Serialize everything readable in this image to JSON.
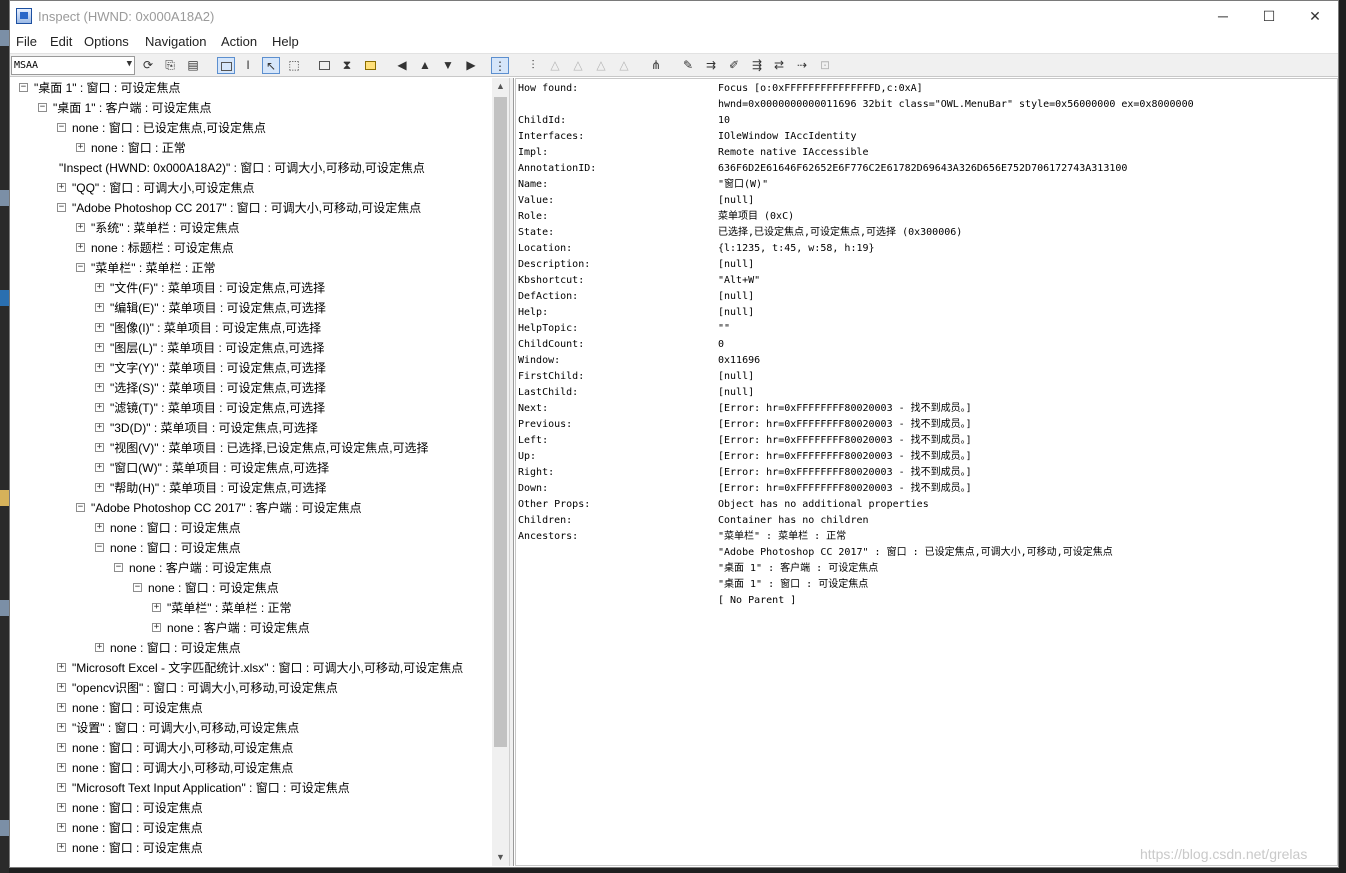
{
  "window": {
    "title": "Inspect  (HWND: 0x000A18A2)",
    "controls": {
      "minimize": "─",
      "maximize": "☐",
      "close": "✕"
    }
  },
  "menu": [
    "File",
    "Edit",
    "Options",
    "Navigation",
    "Action",
    "Help"
  ],
  "toolbar": {
    "mode": "MSAA"
  },
  "tree": [
    {
      "text": "\"桌面 1\" : 窗口 : 可设定焦点",
      "exp": "−"
    },
    {
      "text": "\"桌面 1\" : 客户端 : 可设定焦点",
      "exp": "−"
    },
    {
      "text": "none : 窗口 : 已设定焦点,可设定焦点",
      "exp": "−"
    },
    {
      "text": "none : 窗口 : 正常",
      "exp": "+"
    },
    {
      "text": "\"Inspect  (HWND: 0x000A18A2)\" : 窗口 : 可调大小,可移动,可设定焦点",
      "exp": ""
    },
    {
      "text": "\"QQ\" : 窗口 : 可调大小,可设定焦点",
      "exp": "+"
    },
    {
      "text": "\"Adobe Photoshop CC 2017\" : 窗口 : 可调大小,可移动,可设定焦点",
      "exp": "−"
    },
    {
      "text": "\"系统\" : 菜单栏 : 可设定焦点",
      "exp": "+"
    },
    {
      "text": "none : 标题栏 : 可设定焦点",
      "exp": "+"
    },
    {
      "text": "\"菜单栏\" : 菜单栏 : 正常",
      "exp": "−"
    },
    {
      "text": "\"文件(F)\" : 菜单项目 : 可设定焦点,可选择",
      "exp": "+"
    },
    {
      "text": "\"编辑(E)\" : 菜单项目 : 可设定焦点,可选择",
      "exp": "+"
    },
    {
      "text": "\"图像(I)\" : 菜单项目 : 可设定焦点,可选择",
      "exp": "+"
    },
    {
      "text": "\"图层(L)\" : 菜单项目 : 可设定焦点,可选择",
      "exp": "+"
    },
    {
      "text": "\"文字(Y)\" : 菜单项目 : 可设定焦点,可选择",
      "exp": "+"
    },
    {
      "text": "\"选择(S)\" : 菜单项目 : 可设定焦点,可选择",
      "exp": "+"
    },
    {
      "text": "\"滤镜(T)\" : 菜单项目 : 可设定焦点,可选择",
      "exp": "+"
    },
    {
      "text": "\"3D(D)\" : 菜单项目 : 可设定焦点,可选择",
      "exp": "+"
    },
    {
      "text": "\"视图(V)\" : 菜单项目 : 已选择,已设定焦点,可设定焦点,可选择",
      "exp": "+"
    },
    {
      "text": "\"窗口(W)\" : 菜单项目 : 可设定焦点,可选择",
      "exp": "+"
    },
    {
      "text": "\"帮助(H)\" : 菜单项目 : 可设定焦点,可选择",
      "exp": "+"
    },
    {
      "text": "\"Adobe Photoshop CC 2017\" : 客户端 : 可设定焦点",
      "exp": "−"
    },
    {
      "text": "none : 窗口 : 可设定焦点",
      "exp": "+"
    },
    {
      "text": "none : 窗口 : 可设定焦点",
      "exp": "−"
    },
    {
      "text": "none : 客户端 : 可设定焦点",
      "exp": "−"
    },
    {
      "text": "none : 窗口 : 可设定焦点",
      "exp": "−"
    },
    {
      "text": "\"菜单栏\" : 菜单栏 : 正常",
      "exp": "+"
    },
    {
      "text": "none : 客户端 : 可设定焦点",
      "exp": "+"
    },
    {
      "text": "none : 窗口 : 可设定焦点",
      "exp": "+"
    },
    {
      "text": "\"Microsoft Excel - 文字匹配统计.xlsx\" : 窗口 : 可调大小,可移动,可设定焦点",
      "exp": "+"
    },
    {
      "text": "\"opencv识图\" : 窗口 : 可调大小,可移动,可设定焦点",
      "exp": "+"
    },
    {
      "text": "none : 窗口 : 可设定焦点",
      "exp": "+"
    },
    {
      "text": "\"设置\" : 窗口 : 可调大小,可移动,可设定焦点",
      "exp": "+"
    },
    {
      "text": "none : 窗口 : 可调大小,可移动,可设定焦点",
      "exp": "+"
    },
    {
      "text": "none : 窗口 : 可调大小,可移动,可设定焦点",
      "exp": "+"
    },
    {
      "text": "\"Microsoft Text Input Application\" : 窗口 : 可设定焦点",
      "exp": "+"
    },
    {
      "text": "none : 窗口 : 可设定焦点",
      "exp": "+"
    },
    {
      "text": "none : 窗口 : 可设定焦点",
      "exp": "+"
    },
    {
      "text": "none : 窗口 : 可设定焦点",
      "exp": "+"
    }
  ],
  "properties": [
    {
      "key": "How found:",
      "val": "Focus [o:0xFFFFFFFFFFFFFFFD,c:0xA]"
    },
    {
      "key": "",
      "val": "hwnd=0x0000000000011696 32bit class=\"OWL.MenuBar\" style=0x56000000 ex=0x8000000"
    },
    {
      "key": "ChildId:",
      "val": "10"
    },
    {
      "key": "Interfaces:",
      "val": "IOleWindow IAccIdentity"
    },
    {
      "key": "Impl:",
      "val": "Remote native IAccessible"
    },
    {
      "key": "AnnotationID:",
      "val": "636F6D2E61646F62652E6F776C2E61782D69643A326D656E752D706172743A313100"
    },
    {
      "key": "Name:",
      "val": "\"窗口(W)\""
    },
    {
      "key": "Value:",
      "val": "[null]"
    },
    {
      "key": "Role:",
      "val": "菜单项目 (0xC)"
    },
    {
      "key": "State:",
      "val": "已选择,已设定焦点,可设定焦点,可选择 (0x300006)"
    },
    {
      "key": "Location:",
      "val": "{l:1235, t:45, w:58, h:19}"
    },
    {
      "key": "Description:",
      "val": "[null]"
    },
    {
      "key": "Kbshortcut:",
      "val": "\"Alt+W\""
    },
    {
      "key": "DefAction:",
      "val": "[null]"
    },
    {
      "key": "Help:",
      "val": "[null]"
    },
    {
      "key": "HelpTopic:",
      "val": "\"\""
    },
    {
      "key": "ChildCount:",
      "val": "0"
    },
    {
      "key": "Window:",
      "val": "0x11696"
    },
    {
      "key": "FirstChild:",
      "val": "[null]"
    },
    {
      "key": "LastChild:",
      "val": "[null]"
    },
    {
      "key": "Next:",
      "val": "[Error: hr=0xFFFFFFFF80020003 - 找不到成员。]"
    },
    {
      "key": "Previous:",
      "val": "[Error: hr=0xFFFFFFFF80020003 - 找不到成员。]"
    },
    {
      "key": "Left:",
      "val": "[Error: hr=0xFFFFFFFF80020003 - 找不到成员。]"
    },
    {
      "key": "Up:",
      "val": "[Error: hr=0xFFFFFFFF80020003 - 找不到成员。]"
    },
    {
      "key": "Right:",
      "val": "[Error: hr=0xFFFFFFFF80020003 - 找不到成员。]"
    },
    {
      "key": "Down:",
      "val": "[Error: hr=0xFFFFFFFF80020003 - 找不到成员。]"
    },
    {
      "key": "Other Props:",
      "val": "Object has no additional properties"
    },
    {
      "key": "Children:",
      "val": "Container has no children"
    },
    {
      "key": "Ancestors:",
      "val": "\"菜单栏\" : 菜单栏 : 正常"
    },
    {
      "key": "",
      "val": "\"Adobe Photoshop CC 2017\" : 窗口 : 已设定焦点,可调大小,可移动,可设定焦点"
    },
    {
      "key": "",
      "val": "\"桌面 1\" : 客户端 : 可设定焦点"
    },
    {
      "key": "",
      "val": "\"桌面 1\" : 窗口 : 可设定焦点"
    },
    {
      "key": "",
      "val": "[ No Parent ]"
    }
  ],
  "watermark": "https://blog.csdn.net/grelas"
}
